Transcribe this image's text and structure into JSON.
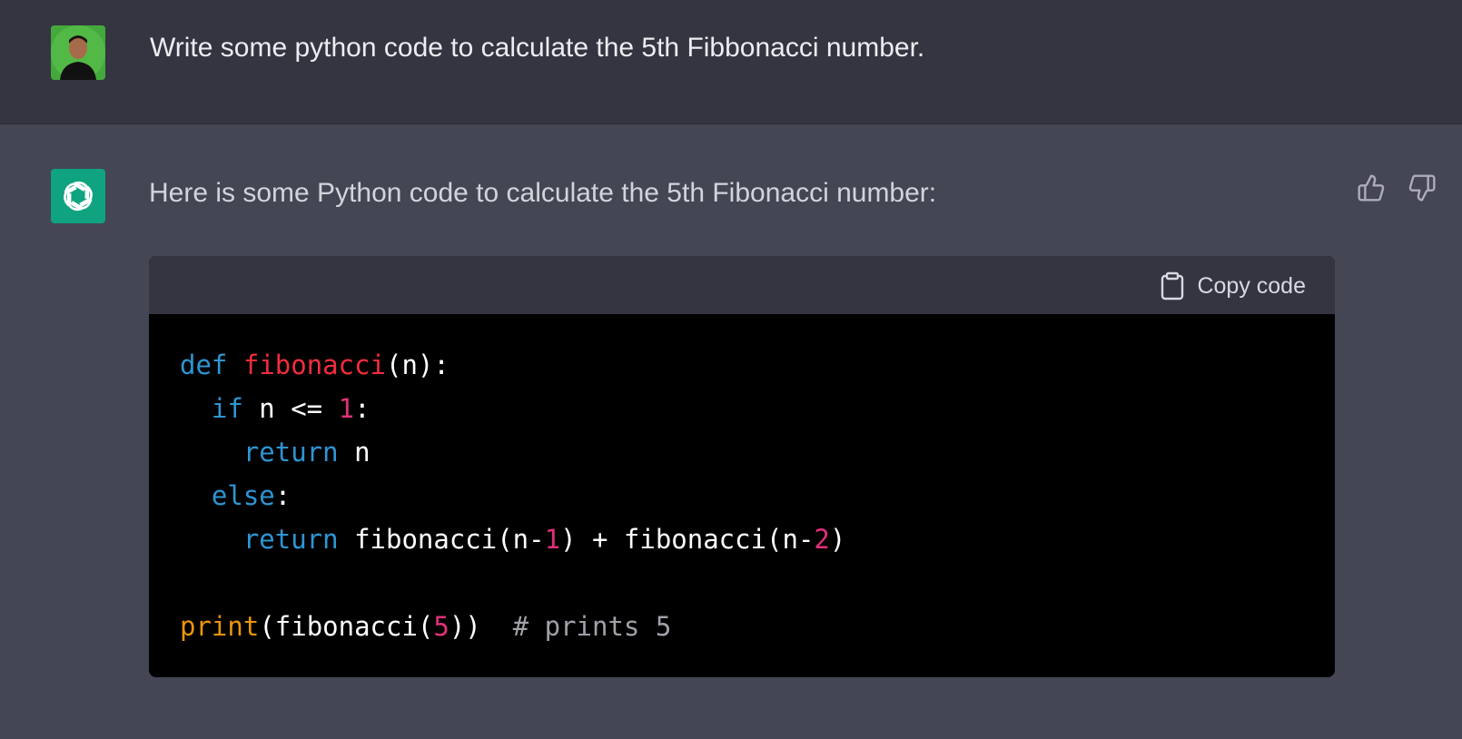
{
  "user_message": {
    "text": "Write some python code to calculate the 5th Fibbonacci number."
  },
  "assistant_message": {
    "intro": "Here is some Python code to calculate the 5th Fibonacci number:",
    "code_block": {
      "copy_label": "Copy code",
      "lines": [
        [
          {
            "t": "def",
            "c": "kw"
          },
          {
            "t": " "
          },
          {
            "t": "fibonacci",
            "c": "fn"
          },
          {
            "t": "(n):"
          }
        ],
        [
          {
            "t": "  "
          },
          {
            "t": "if",
            "c": "kw"
          },
          {
            "t": " n <= "
          },
          {
            "t": "1",
            "c": "num"
          },
          {
            "t": ":"
          }
        ],
        [
          {
            "t": "    "
          },
          {
            "t": "return",
            "c": "kw"
          },
          {
            "t": " n"
          }
        ],
        [
          {
            "t": "  "
          },
          {
            "t": "else",
            "c": "kw"
          },
          {
            "t": ":"
          }
        ],
        [
          {
            "t": "    "
          },
          {
            "t": "return",
            "c": "kw"
          },
          {
            "t": " fibonacci(n-"
          },
          {
            "t": "1",
            "c": "num"
          },
          {
            "t": ") + fibonacci(n-"
          },
          {
            "t": "2",
            "c": "num"
          },
          {
            "t": ")"
          }
        ],
        [],
        [
          {
            "t": "print",
            "c": "bi"
          },
          {
            "t": "(fibonacci("
          },
          {
            "t": "5",
            "c": "num"
          },
          {
            "t": "))  "
          },
          {
            "t": "# prints 5",
            "c": "cm"
          }
        ]
      ]
    }
  },
  "icons": {
    "user_avatar": "user-avatar-photo",
    "bot_avatar": "openai-logo-icon",
    "thumbs_up": "thumbs-up-icon",
    "thumbs_down": "thumbs-down-icon",
    "copy": "clipboard-icon"
  },
  "colors": {
    "user_row_bg": "#343541",
    "assistant_row_bg": "#444654",
    "bot_avatar_bg": "#10a37f",
    "code_bg": "#000000",
    "keyword": "#2e95d3",
    "function": "#f22c3d",
    "number": "#df3079",
    "builtin": "#e9950c",
    "comment": "#a0a0a8"
  }
}
